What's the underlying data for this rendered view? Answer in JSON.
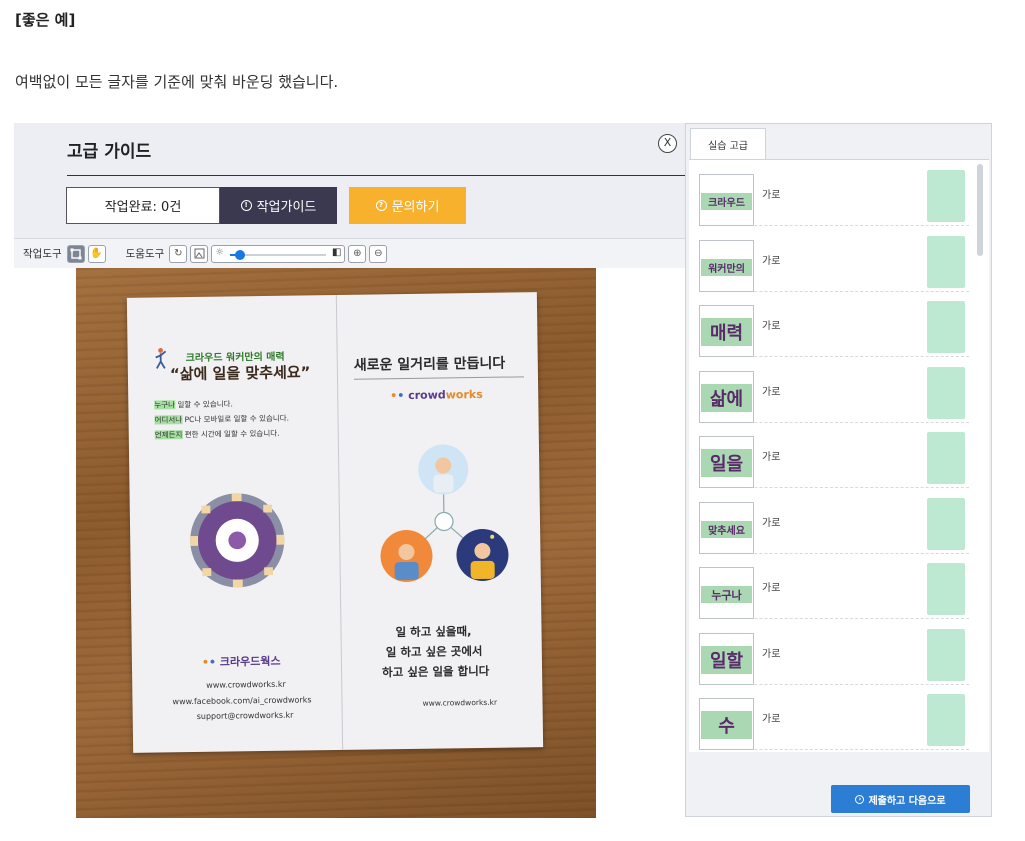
{
  "heading": "[좋은 예]",
  "description": "여백없이 모든 글자를 기준에 맞춰 바운딩 했습니다.",
  "tool": {
    "title": "고급 가이드",
    "close_label": "X",
    "done_label": "작업완료: 0건",
    "guide_label": "작업가이드",
    "ask_label": "문의하기",
    "guide_color": "#3a3950",
    "ask_color": "#f7b12c"
  },
  "toolbar": {
    "work_tools_label": "작업도구",
    "help_tools_label": "도움도구",
    "brightness_level": 0.1
  },
  "photo": {
    "left_small": "크라우드 워커만의 매력",
    "left_big": "“삶에 일을 맞추세요”",
    "lines": [
      {
        "hl": "누구나",
        "rest": " 일할 수 있습니다."
      },
      {
        "hl": "어디서나",
        "rest": " PC나 모바일로 일할 수 있습니다."
      },
      {
        "hl": "언제든지",
        "rest": " 편한 시간에 일할 수 있습니다."
      }
    ],
    "brand": "크라우드웍스",
    "urls": [
      "www.crowdworks.kr",
      "www.facebook.com/ai_crowdworks",
      "support@crowdworks.kr"
    ],
    "right_title": "새로운 일거리를 만듭니다",
    "logo_a": "crowd",
    "logo_b": "works",
    "slogan": [
      "일 하고 싶을때,",
      "일 하고 싶은 곳에서",
      "하고 싶은 일을 합니다"
    ],
    "web": "www.crowdworks.kr"
  },
  "panel": {
    "tab_label": "실습 고급",
    "submit_label": "제출하고 다음으로",
    "submit_color": "#2c7dd4",
    "items": [
      {
        "word": "크라우드",
        "dir": "가로"
      },
      {
        "word": "워커만의",
        "dir": "가로"
      },
      {
        "word": "매력",
        "dir": "가로"
      },
      {
        "word": "삶에",
        "dir": "가로"
      },
      {
        "word": "일을",
        "dir": "가로"
      },
      {
        "word": "맞추세요",
        "dir": "가로"
      },
      {
        "word": "누구나",
        "dir": "가로"
      },
      {
        "word": "일할",
        "dir": "가로"
      },
      {
        "word": "수",
        "dir": "가로"
      }
    ]
  }
}
